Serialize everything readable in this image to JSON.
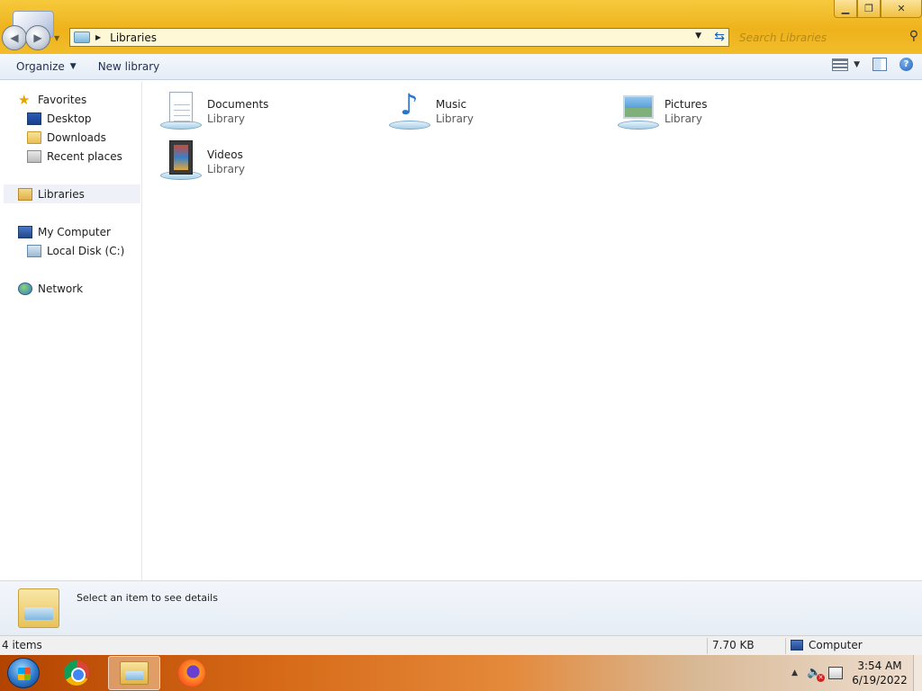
{
  "window": {
    "minimize_glyph": "▁",
    "maximize_glyph": "❐",
    "close_glyph": "✕"
  },
  "address": {
    "path": "Libraries",
    "search_placeholder": "Search Libraries"
  },
  "toolbar": {
    "organize_label": "Organize",
    "new_library_label": "New library"
  },
  "navigation": {
    "favorites": "Favorites",
    "desktop": "Desktop",
    "downloads": "Downloads",
    "recent_places": "Recent places",
    "libraries": "Libraries",
    "my_computer": "My Computer",
    "local_disk": "Local Disk (C:)",
    "network": "Network"
  },
  "libraries": [
    {
      "name": "Documents",
      "type": "Library",
      "icon": "documents-library-icon"
    },
    {
      "name": "Music",
      "type": "Library",
      "icon": "music-library-icon"
    },
    {
      "name": "Pictures",
      "type": "Library",
      "icon": "pictures-library-icon"
    },
    {
      "name": "Videos",
      "type": "Library",
      "icon": "videos-library-icon"
    }
  ],
  "details": {
    "message": "Select an item to see details"
  },
  "status": {
    "item_count": "4 items",
    "size": "7.70 KB",
    "location": "Computer"
  },
  "taskbar": {
    "time": "3:54 AM",
    "date": "6/19/2022"
  },
  "colors": {
    "title_accent": "#f2bd2b",
    "taskbar_accent": "#d66a18"
  }
}
